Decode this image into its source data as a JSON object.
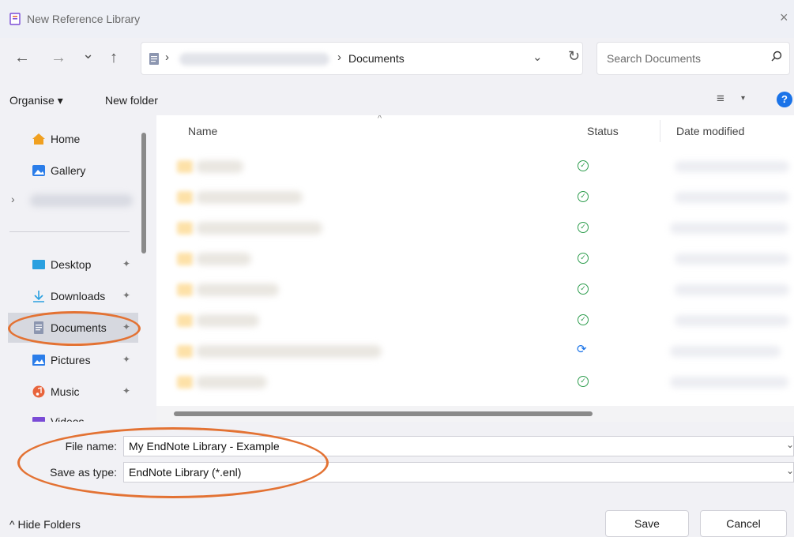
{
  "window": {
    "title": "New Reference Library",
    "close_glyph": "×"
  },
  "nav_buttons": {
    "back": "←",
    "forward": "→",
    "recent": "⌄",
    "up": "↑"
  },
  "address": {
    "separator": "›",
    "current_folder": "Documents",
    "dropdown_glyph": "⌄",
    "refresh_glyph": "↻"
  },
  "search": {
    "placeholder": "Search Documents",
    "icon": "search-icon"
  },
  "toolbar": {
    "organise": "Organise ▾",
    "new_folder": "New folder",
    "view_glyph": "≡",
    "view_drop": "▾",
    "help": "?"
  },
  "sidebar": {
    "expand_glyph": "›",
    "items": [
      {
        "label": "Home",
        "icon": "home-icon",
        "color": "#f0a020"
      },
      {
        "label": "Gallery",
        "icon": "gallery-icon",
        "color": "#2b7de9"
      },
      {
        "label": "Desktop",
        "icon": "desktop-icon",
        "color": "#2aa0e0"
      },
      {
        "label": "Downloads",
        "icon": "download-icon",
        "color": "#2aa0e0"
      },
      {
        "label": "Documents",
        "icon": "documents-icon",
        "color": "#8c96b0"
      },
      {
        "label": "Pictures",
        "icon": "pictures-icon",
        "color": "#2b7de9"
      },
      {
        "label": "Music",
        "icon": "music-icon",
        "color": "#e8643c"
      },
      {
        "label": "Videos",
        "icon": "videos-icon",
        "color": "#7a4bd6"
      }
    ],
    "pin_glyph": "📌"
  },
  "file_list": {
    "columns": {
      "name": "Name",
      "status": "Status",
      "date": "Date modified"
    },
    "sort_glyph": "^",
    "rows": [
      {
        "status": "synced"
      },
      {
        "status": "synced"
      },
      {
        "status": "synced"
      },
      {
        "status": "synced"
      },
      {
        "status": "synced"
      },
      {
        "status": "synced"
      },
      {
        "status": "syncing"
      },
      {
        "status": "synced"
      }
    ],
    "status_ok_glyph": "✓",
    "status_sync_glyph": "⟳"
  },
  "form": {
    "file_name_label": "File name:",
    "file_name_value": "My EndNote Library - Example",
    "type_label": "Save as type:",
    "type_value": "EndNote Library (*.enl)",
    "drop_glyph": "⌄"
  },
  "footer": {
    "hide_folders": "^ Hide Folders",
    "save": "Save",
    "cancel": "Cancel"
  },
  "colors": {
    "annotation": "#e37233",
    "accent": "#1a73e8",
    "status_ok": "#2e9d4e"
  }
}
